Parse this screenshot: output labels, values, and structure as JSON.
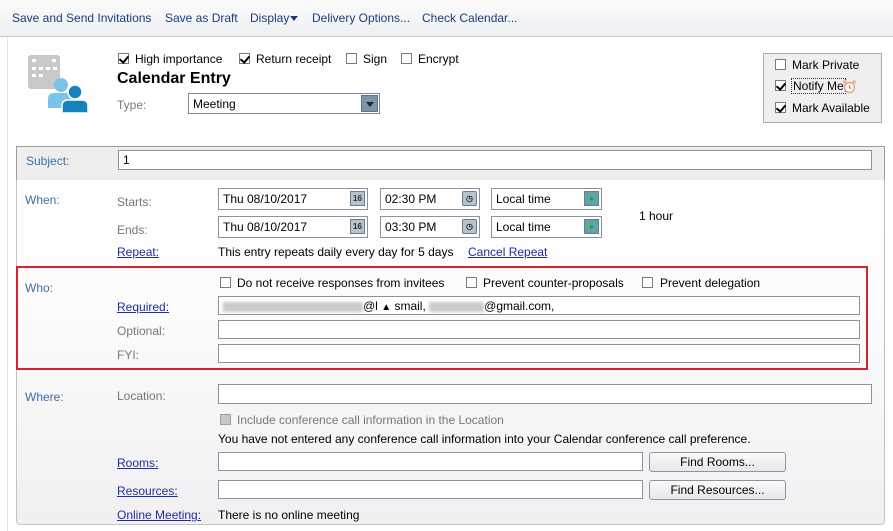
{
  "toolbar": {
    "save_send": "Save and Send Invitations",
    "save_draft": "Save as Draft",
    "display": "Display",
    "delivery_options": "Delivery Options...",
    "check_calendar": "Check Calendar..."
  },
  "header": {
    "icon": "calendar-people-icon",
    "options": [
      {
        "label": "High importance",
        "checked": true
      },
      {
        "label": "Return receipt",
        "checked": true
      },
      {
        "label": "Sign",
        "checked": false
      },
      {
        "label": "Encrypt",
        "checked": false
      }
    ],
    "title": "Calendar Entry",
    "type_label": "Type:",
    "type_value": "Meeting"
  },
  "side_options": [
    {
      "label": "Mark Private",
      "checked": false
    },
    {
      "label": "Notify Me",
      "checked": true,
      "icon": "alarm-clock-icon"
    },
    {
      "label": "Mark Available",
      "checked": true
    }
  ],
  "subject": {
    "label": "Subject:",
    "value": "1"
  },
  "when": {
    "label": "When:",
    "starts_label": "Starts:",
    "ends_label": "Ends:",
    "start_date": "Thu 08/10/2017",
    "start_time": "02:30 PM",
    "start_zone": "Local time",
    "end_date": "Thu 08/10/2017",
    "end_time": "03:30 PM",
    "end_zone": "Local time",
    "date_icon_text": "16",
    "duration": "1 hour",
    "repeat_label": "Repeat:",
    "repeat_text": "This entry repeats daily every day for 5 days",
    "cancel_repeat": "Cancel Repeat"
  },
  "who": {
    "label": "Who:",
    "options": [
      {
        "label": "Do not receive responses from invitees",
        "checked": false
      },
      {
        "label": "Prevent counter-proposals",
        "checked": false
      },
      {
        "label": "Prevent delegation",
        "checked": false
      }
    ],
    "required_label": "Required:",
    "required_visible_1": "@l",
    "required_visible_2": "smail,",
    "required_visible_3": "@gmail.com,",
    "optional_label": "Optional:",
    "optional_value": "",
    "fyi_label": "FYI:",
    "fyi_value": ""
  },
  "where": {
    "label": "Where:",
    "location_label": "Location:",
    "location_value": "",
    "conference_checkbox": "Include conference call information in the Location",
    "conference_note": "You have not entered any conference call information into your Calendar conference call preference.",
    "rooms_label": "Rooms:",
    "rooms_value": "",
    "find_rooms": "Find Rooms...",
    "resources_label": "Resources:",
    "resources_value": "",
    "find_resources": "Find Resources...",
    "online_meeting_label": "Online Meeting:",
    "online_meeting_text": "There is no online meeting"
  }
}
